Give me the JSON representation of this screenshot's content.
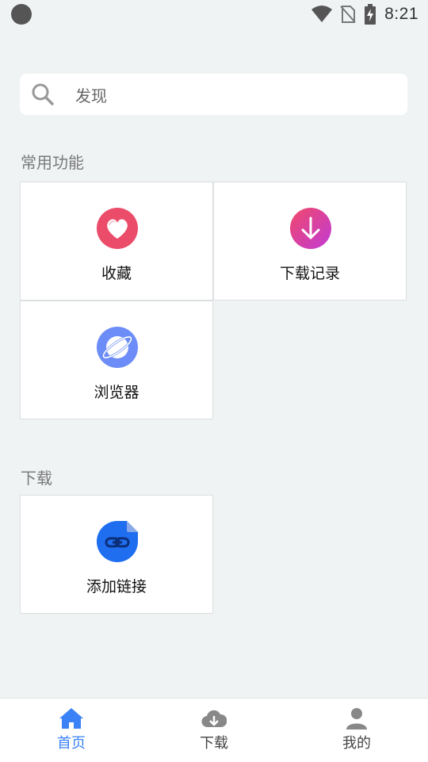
{
  "status_bar": {
    "time": "8:21",
    "icons": [
      "notification-dot-icon",
      "wifi-icon",
      "no-sim-icon",
      "battery-charging-icon"
    ]
  },
  "search": {
    "placeholder": "发现",
    "icon": "search-icon"
  },
  "sections": {
    "common": {
      "title": "常用功能",
      "items": [
        {
          "label": "收藏",
          "icon": "heart-icon",
          "color": "#ea4c69"
        },
        {
          "label": "下载记录",
          "icon": "download-arrow-icon",
          "color": "#e0389a"
        },
        {
          "label": "浏览器",
          "icon": "planet-icon",
          "color": "#6c8cf7"
        }
      ]
    },
    "download": {
      "title": "下载",
      "items": [
        {
          "label": "添加链接",
          "icon": "link-file-icon",
          "color": "#1f6ef0"
        }
      ]
    }
  },
  "tabbar": {
    "tabs": [
      {
        "label": "首页",
        "icon": "home-icon",
        "active": true
      },
      {
        "label": "下载",
        "icon": "cloud-download-icon",
        "active": false
      },
      {
        "label": "我的",
        "icon": "user-icon",
        "active": false
      }
    ],
    "active_color": "#3b82f6",
    "inactive_color": "#888888"
  }
}
